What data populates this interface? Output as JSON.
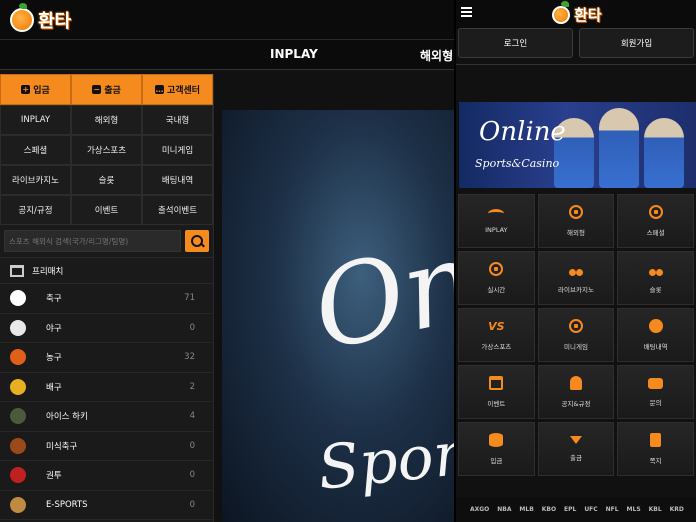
{
  "brand": {
    "name": "환타"
  },
  "desktop": {
    "nav": [
      "INPLAY",
      "해외형"
    ],
    "sidebar": {
      "top_buttons": [
        {
          "label": "입금",
          "icon": "plus-square-icon"
        },
        {
          "label": "출금",
          "icon": "minus-square-icon"
        },
        {
          "label": "고객센터",
          "icon": "chat-bubble-icon"
        }
      ],
      "menu": [
        "INPLAY",
        "해외형",
        "국내형",
        "스페셜",
        "가상스포츠",
        "미니게임",
        "라이브카지노",
        "슬롯",
        "배팅내역",
        "공지/규정",
        "이벤트",
        "출석이벤트"
      ],
      "search_placeholder": "스포츠 해외식 검색(국가/리그명/팀명)",
      "prematch_label": "프리매치",
      "sports": [
        {
          "name": "축구",
          "count": "71",
          "icon": "soccer-ball-icon",
          "color": "#ffffff"
        },
        {
          "name": "야구",
          "count": "0",
          "icon": "baseball-icon",
          "color": "#e8e8e8"
        },
        {
          "name": "농구",
          "count": "32",
          "icon": "basketball-icon",
          "color": "#e0601a"
        },
        {
          "name": "배구",
          "count": "2",
          "icon": "volleyball-icon",
          "color": "#e8b020"
        },
        {
          "name": "아이스 하키",
          "count": "4",
          "icon": "hockey-stick-icon",
          "color": "#4a5a3a"
        },
        {
          "name": "미식축구",
          "count": "0",
          "icon": "football-icon",
          "color": "#9a4a1a"
        },
        {
          "name": "권투",
          "count": "0",
          "icon": "boxing-glove-icon",
          "color": "#c02020"
        },
        {
          "name": "E-SPORTS",
          "count": "0",
          "icon": "esports-icon",
          "color": "#c08a40"
        }
      ]
    }
  },
  "mobile": {
    "buttons": [
      "로그인",
      "회원가입"
    ],
    "banner": {
      "title": "Online",
      "subtitle": "Sports&Casino"
    },
    "grid": [
      {
        "label": "INPLAY",
        "icon": "wifi-icon"
      },
      {
        "label": "해외형",
        "icon": "soccer-icon"
      },
      {
        "label": "스페셜",
        "icon": "soccer-icon"
      },
      {
        "label": "실시간",
        "icon": "soccer-icon"
      },
      {
        "label": "라이브카지노",
        "icon": "cherry-icon"
      },
      {
        "label": "슬롯",
        "icon": "cherry-icon"
      },
      {
        "label": "가상스포츠",
        "icon": "vs-icon"
      },
      {
        "label": "미니게임",
        "icon": "basketball-icon"
      },
      {
        "label": "배팅내역",
        "icon": "coins-icon"
      },
      {
        "label": "이벤트",
        "icon": "calendar-icon"
      },
      {
        "label": "공지&규정",
        "icon": "bell-icon"
      },
      {
        "label": "문의",
        "icon": "chat-icon"
      },
      {
        "label": "입금",
        "icon": "database-icon"
      },
      {
        "label": "출금",
        "icon": "download-icon"
      },
      {
        "label": "쪽지",
        "icon": "clipboard-icon"
      }
    ],
    "partners": [
      "AXGO",
      "NBA",
      "MLB",
      "KBO",
      "EPL",
      "UFC",
      "NFL",
      "MLS",
      "KBL",
      "KRD"
    ]
  },
  "colors": {
    "accent": "#f58a1f",
    "background": "#111111"
  }
}
